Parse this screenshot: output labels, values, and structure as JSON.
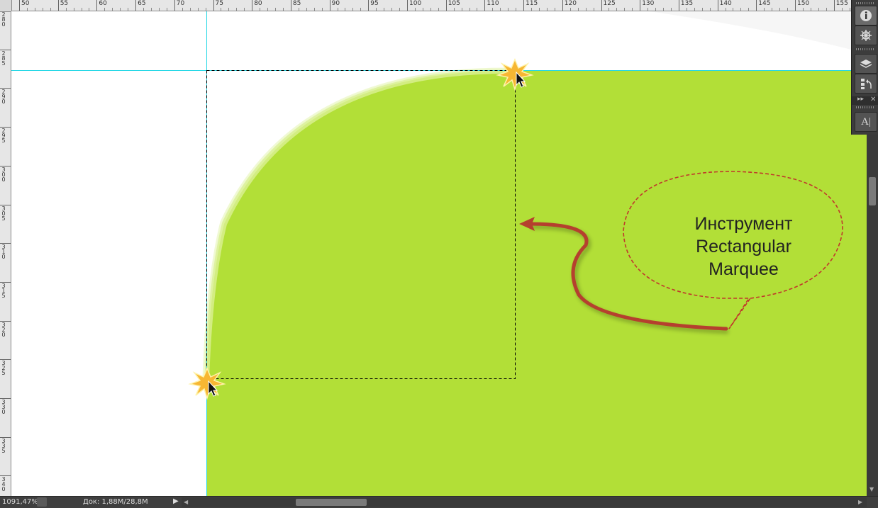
{
  "ruler": {
    "horizontal_labels": [
      "50",
      "55",
      "60",
      "65",
      "70",
      "75",
      "80",
      "85",
      "90",
      "95",
      "100",
      "105",
      "110",
      "115",
      "120",
      "125",
      "130",
      "135",
      "140",
      "145",
      "150",
      "155"
    ],
    "vertical_labels": [
      "280",
      "285",
      "290",
      "295",
      "300",
      "305",
      "310",
      "315",
      "320",
      "325",
      "330",
      "335",
      "340"
    ]
  },
  "canvas": {
    "shape_color": "#b2df37",
    "guide_color": "#28d8e6",
    "marquee_color": "#000000"
  },
  "annotation": {
    "callout_line1": "Инструмент",
    "callout_line2": "Rectangular",
    "callout_line3": "Marquee",
    "arrow_color": "#b5402e",
    "bubble_border_color": "#c0392b"
  },
  "panels": {
    "icons": [
      "info-icon",
      "navigator-icon",
      "layers-icon",
      "history-icon",
      "character-icon"
    ],
    "character_label": "A|"
  },
  "status": {
    "zoom": "1091,47%",
    "doc_info": "Док: 1,88M/28,8M"
  }
}
